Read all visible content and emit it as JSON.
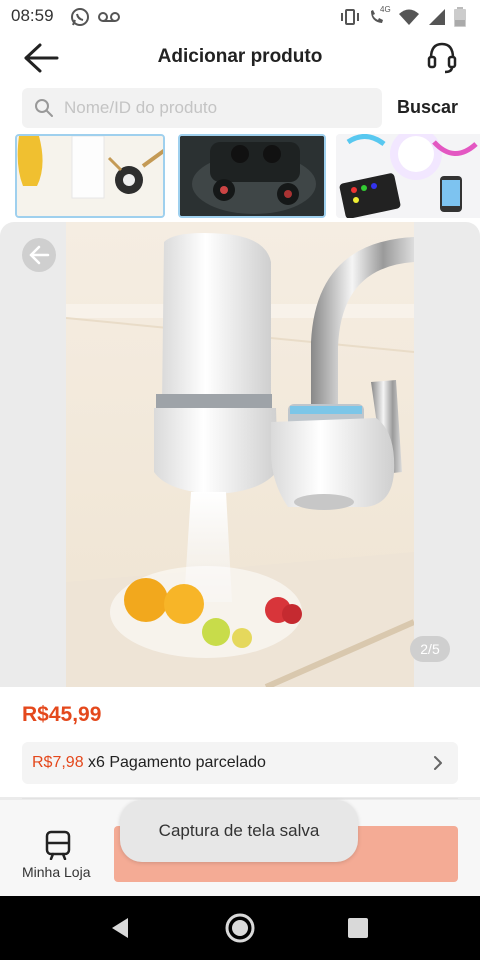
{
  "status_bar": {
    "time": "08:59",
    "left_icons": [
      "whatsapp-icon",
      "voicemail-icon"
    ],
    "right_icons": [
      "vibrate-icon",
      "4g-call-icon",
      "wifi-icon",
      "signal-icon",
      "battery-icon"
    ],
    "network_label": "4G"
  },
  "header": {
    "title": "Adicionar produto",
    "back_icon": "arrow-left-icon",
    "support_icon": "headset-icon"
  },
  "search": {
    "placeholder": "Nome/ID do produto",
    "value": "",
    "button_label": "Buscar"
  },
  "thumbnails": [
    {
      "label": "lamp-product",
      "selected": true
    },
    {
      "label": "earbuds-product",
      "selected": true
    },
    {
      "label": "led-bulb-product",
      "selected": false
    }
  ],
  "product": {
    "image_subject": "faucet-water-filter",
    "page_indicator": "2/5",
    "price": "R$45,99",
    "installment": {
      "price": "R$7,98",
      "text": "x6 Pagamento parcelado"
    }
  },
  "bottom_bar": {
    "store_label": "Minha Loja",
    "store_icon": "store-icon"
  },
  "toast": {
    "text": "Captura de tela salva"
  },
  "colors": {
    "accent": "#e4481c",
    "action_button": "#f4ab95",
    "thumb_border": "#9fd0ee"
  }
}
